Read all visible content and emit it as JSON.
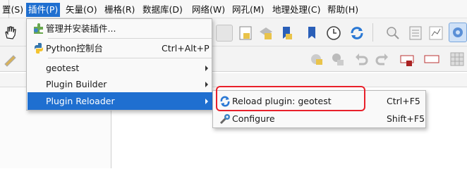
{
  "menubar": {
    "items": [
      {
        "label": "置(S)"
      },
      {
        "label": "插件(P)"
      },
      {
        "label": "矢量(O)"
      },
      {
        "label": "栅格(R)"
      },
      {
        "label": "数据库(D)"
      },
      {
        "label": "网络(W)"
      },
      {
        "label": "网孔(M)"
      },
      {
        "label": "地理处理(C)"
      },
      {
        "label": "帮助(H)"
      }
    ],
    "active_item": "插件(P)"
  },
  "plugins_menu": {
    "items": [
      {
        "label": "管理并安装插件...",
        "shortcut": "",
        "icon": "puzzle-plugin-icon"
      },
      {
        "label": "Python控制台",
        "shortcut": "Ctrl+Alt+P",
        "icon": "python-icon"
      },
      {
        "label": "geotest",
        "shortcut": "",
        "submenu": true
      },
      {
        "label": "Plugin Builder",
        "shortcut": "",
        "submenu": true
      },
      {
        "label": "Plugin Reloader",
        "shortcut": "",
        "submenu": true,
        "highlighted": true
      }
    ]
  },
  "reloader_submenu": {
    "items": [
      {
        "label": "Reload plugin: geotest",
        "shortcut": "Ctrl+F5",
        "icon": "reload-icon"
      },
      {
        "label": "Configure",
        "shortcut": "Shift+F5",
        "icon": "configure-icon"
      }
    ]
  },
  "colors": {
    "highlight": "#1f6fd0",
    "annotation_box": "#e8202a"
  }
}
